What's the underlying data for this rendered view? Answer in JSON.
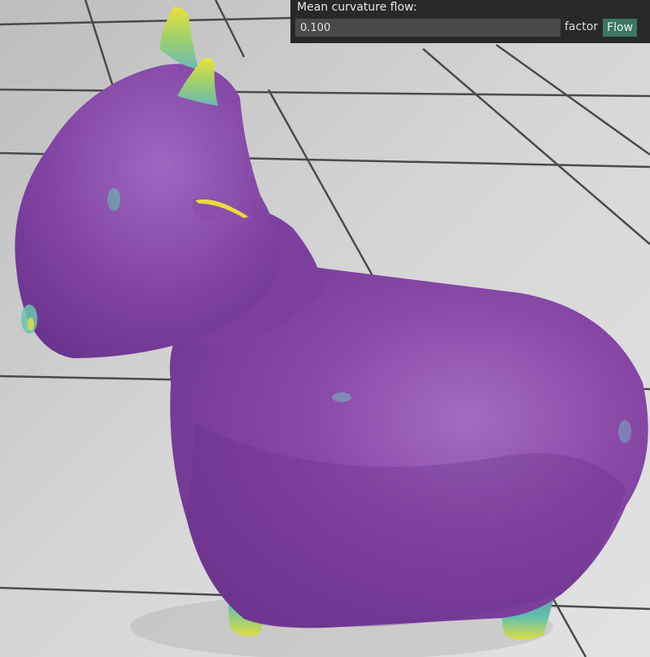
{
  "panel": {
    "title": "Mean curvature flow:",
    "factor_value": "0.100",
    "factor_label": "factor",
    "flow_button_label": "Flow"
  },
  "colors": {
    "panel_bg": "#1c1c1c",
    "input_bg": "#4a4a4a",
    "button_bg": "#3b7763",
    "mesh_base": "#8a4aa8",
    "curvature_high": "#e6dd3a",
    "curvature_mid": "#5fc8b0"
  }
}
